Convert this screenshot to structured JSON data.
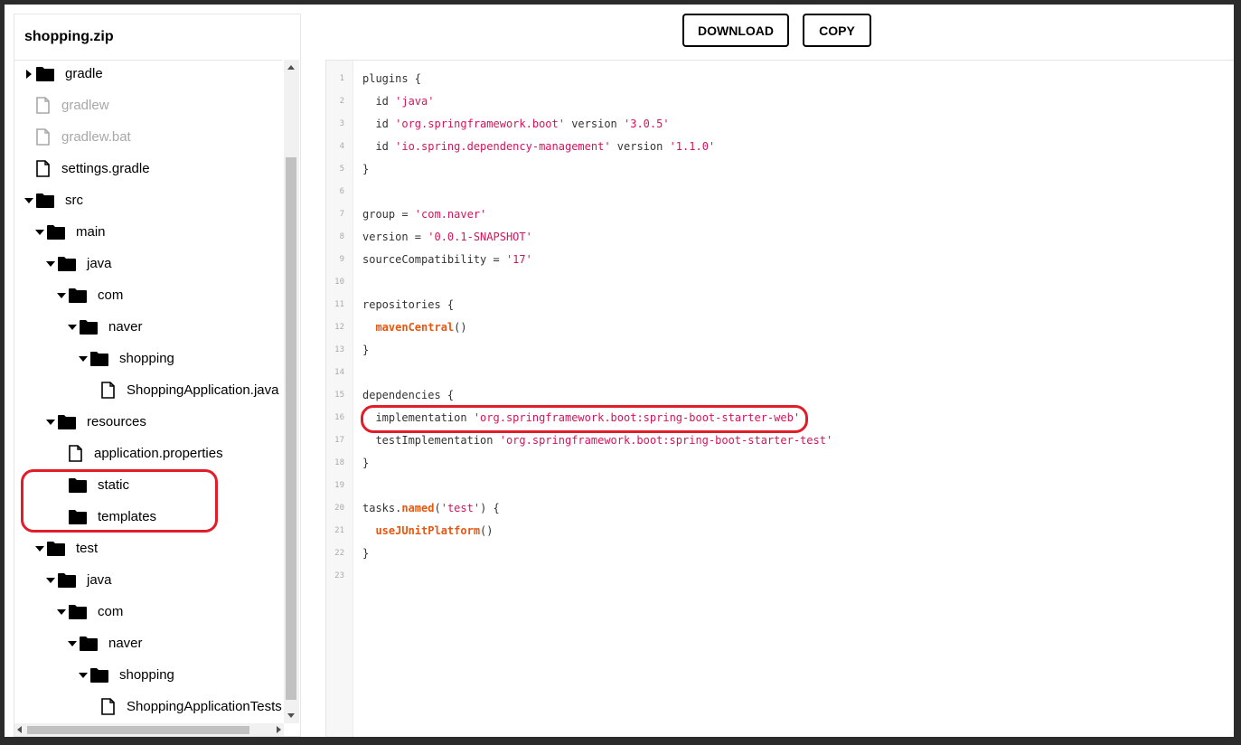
{
  "sidebar": {
    "title": "shopping.zip",
    "tree": [
      {
        "label": "gradle",
        "type": "folder",
        "depth": 0,
        "expanded": false,
        "disabled": false
      },
      {
        "label": "gradlew",
        "type": "file",
        "depth": 0,
        "disabled": true
      },
      {
        "label": "gradlew.bat",
        "type": "file",
        "depth": 0,
        "disabled": true
      },
      {
        "label": "settings.gradle",
        "type": "file",
        "depth": 0,
        "disabled": false
      },
      {
        "label": "src",
        "type": "folder",
        "depth": 0,
        "expanded": true,
        "disabled": false
      },
      {
        "label": "main",
        "type": "folder",
        "depth": 1,
        "expanded": true,
        "disabled": false
      },
      {
        "label": "java",
        "type": "folder",
        "depth": 2,
        "expanded": true,
        "disabled": false
      },
      {
        "label": "com",
        "type": "folder",
        "depth": 3,
        "expanded": true,
        "disabled": false
      },
      {
        "label": "naver",
        "type": "folder",
        "depth": 4,
        "expanded": true,
        "disabled": false
      },
      {
        "label": "shopping",
        "type": "folder",
        "depth": 5,
        "expanded": true,
        "disabled": false
      },
      {
        "label": "ShoppingApplication.java",
        "type": "file",
        "depth": 6,
        "disabled": false
      },
      {
        "label": "resources",
        "type": "folder",
        "depth": 2,
        "expanded": true,
        "disabled": false
      },
      {
        "label": "application.properties",
        "type": "file",
        "depth": 3,
        "disabled": false
      },
      {
        "label": "static",
        "type": "folder",
        "depth": 3,
        "expanded": null,
        "disabled": false
      },
      {
        "label": "templates",
        "type": "folder",
        "depth": 3,
        "expanded": null,
        "disabled": false
      },
      {
        "label": "test",
        "type": "folder",
        "depth": 1,
        "expanded": true,
        "disabled": false
      },
      {
        "label": "java",
        "type": "folder",
        "depth": 2,
        "expanded": true,
        "disabled": false
      },
      {
        "label": "com",
        "type": "folder",
        "depth": 3,
        "expanded": true,
        "disabled": false
      },
      {
        "label": "naver",
        "type": "folder",
        "depth": 4,
        "expanded": true,
        "disabled": false
      },
      {
        "label": "shopping",
        "type": "folder",
        "depth": 5,
        "expanded": true,
        "disabled": false
      },
      {
        "label": "ShoppingApplicationTests",
        "type": "file",
        "depth": 6,
        "disabled": false
      }
    ]
  },
  "toolbar": {
    "download_label": "DOWNLOAD",
    "copy_label": "COPY"
  },
  "code": {
    "lines": [
      [
        {
          "t": "plugins {",
          "k": "plain"
        }
      ],
      [
        {
          "t": "  id ",
          "k": "plain"
        },
        {
          "t": "'java'",
          "k": "str"
        }
      ],
      [
        {
          "t": "  id ",
          "k": "plain"
        },
        {
          "t": "'org.springframework.boot'",
          "k": "str"
        },
        {
          "t": " version ",
          "k": "plain"
        },
        {
          "t": "'3.0.5'",
          "k": "str"
        }
      ],
      [
        {
          "t": "  id ",
          "k": "plain"
        },
        {
          "t": "'io.spring.dependency-management'",
          "k": "str"
        },
        {
          "t": " version ",
          "k": "plain"
        },
        {
          "t": "'1.1.0'",
          "k": "str"
        }
      ],
      [
        {
          "t": "}",
          "k": "plain"
        }
      ],
      [],
      [
        {
          "t": "group = ",
          "k": "plain"
        },
        {
          "t": "'com.naver'",
          "k": "str"
        }
      ],
      [
        {
          "t": "version = ",
          "k": "plain"
        },
        {
          "t": "'0.0.1-SNAPSHOT'",
          "k": "str"
        }
      ],
      [
        {
          "t": "sourceCompatibility = ",
          "k": "plain"
        },
        {
          "t": "'17'",
          "k": "str"
        }
      ],
      [],
      [
        {
          "t": "repositories {",
          "k": "plain"
        }
      ],
      [
        {
          "t": "  ",
          "k": "plain"
        },
        {
          "t": "mavenCentral",
          "k": "fn"
        },
        {
          "t": "()",
          "k": "plain"
        }
      ],
      [
        {
          "t": "}",
          "k": "plain"
        }
      ],
      [],
      [
        {
          "t": "dependencies {",
          "k": "plain"
        }
      ],
      [
        {
          "t": "  implementation ",
          "k": "plain"
        },
        {
          "t": "'org.springframework.boot:spring-boot-starter-web'",
          "k": "str"
        }
      ],
      [
        {
          "t": "  testImplementation ",
          "k": "plain"
        },
        {
          "t": "'org.springframework.boot:spring-boot-starter-test'",
          "k": "str"
        }
      ],
      [
        {
          "t": "}",
          "k": "plain"
        }
      ],
      [],
      [
        {
          "t": "tasks.",
          "k": "plain"
        },
        {
          "t": "named",
          "k": "fn"
        },
        {
          "t": "(",
          "k": "plain"
        },
        {
          "t": "'test'",
          "k": "str"
        },
        {
          "t": ") {",
          "k": "plain"
        }
      ],
      [
        {
          "t": "  ",
          "k": "plain"
        },
        {
          "t": "useJUnitPlatform",
          "k": "fn"
        },
        {
          "t": "()",
          "k": "plain"
        }
      ],
      [
        {
          "t": "}",
          "k": "plain"
        }
      ],
      []
    ]
  },
  "colors": {
    "highlight": "#e11d2a",
    "string": "#d4145a",
    "function": "#e8570e"
  }
}
